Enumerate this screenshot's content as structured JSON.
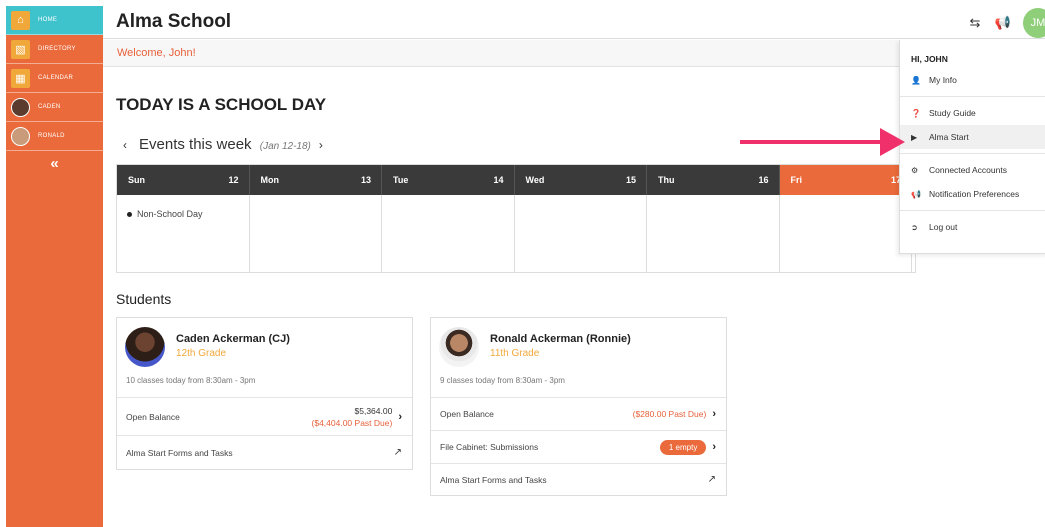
{
  "app": {
    "title": "Alma School",
    "welcome": "Welcome, John!"
  },
  "sidebar": {
    "items": [
      {
        "label": "HOME",
        "icon": "home-icon",
        "active": true
      },
      {
        "label": "DIRECTORY",
        "icon": "directory-icon"
      },
      {
        "label": "CALENDAR",
        "icon": "calendar-icon"
      },
      {
        "label": "CADEN",
        "icon": "avatar"
      },
      {
        "label": "RONALD",
        "icon": "avatar"
      }
    ],
    "collapse": "«"
  },
  "header": {
    "icons": [
      "swap-icon",
      "megaphone-icon"
    ],
    "user_initials": "JM"
  },
  "main": {
    "day_title": "TODAY IS A SCHOOL DAY",
    "events_title": "Events this week",
    "events_range": "(Jan 12-18)",
    "prev": "‹",
    "next": "›",
    "calendar": {
      "days": [
        {
          "name": "Sun",
          "date": "12",
          "events": [
            "Non-School Day"
          ]
        },
        {
          "name": "Mon",
          "date": "13",
          "events": []
        },
        {
          "name": "Tue",
          "date": "14",
          "events": []
        },
        {
          "name": "Wed",
          "date": "15",
          "events": []
        },
        {
          "name": "Thu",
          "date": "16",
          "events": []
        },
        {
          "name": "Fri",
          "date": "17",
          "events": [],
          "today": true
        }
      ]
    },
    "students_title": "Students",
    "students": [
      {
        "name": "Caden Ackerman (CJ)",
        "grade": "12th Grade",
        "classes": "10 classes today from 8:30am - 3pm",
        "open_balance_label": "Open Balance",
        "balance": "$5,364.00",
        "past_due": "($4,404.00 Past Due)",
        "forms_label": "Alma Start Forms and Tasks"
      },
      {
        "name": "Ronald Ackerman (Ronnie)",
        "grade": "11th Grade",
        "classes": "9 classes today from 8:30am - 3pm",
        "open_balance_label": "Open Balance",
        "past_due": "($280.00 Past Due)",
        "file_cabinet_label": "File Cabinet: Submissions",
        "file_cabinet_badge": "1 empty",
        "forms_label": "Alma Start Forms and Tasks"
      }
    ]
  },
  "dropdown": {
    "greeting": "HI, JOHN",
    "items": {
      "my_info": "My Info",
      "study_guide": "Study Guide",
      "alma_start": "Alma Start",
      "connected_accounts": "Connected Accounts",
      "notification_preferences": "Notification Preferences",
      "log_out": "Log out"
    }
  },
  "colors": {
    "accent": "#ea6a3b",
    "teal": "#3ec2cc",
    "grade": "#f0a83a",
    "arrow": "#f0306a"
  }
}
